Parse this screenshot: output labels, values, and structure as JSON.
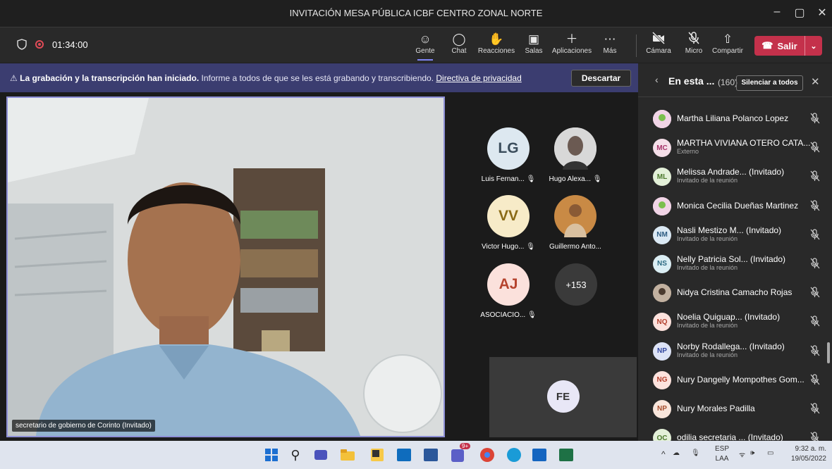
{
  "window": {
    "title": "INVITACIÓN MESA PÚBLICA ICBF CENTRO ZONAL NORTE"
  },
  "toolbar": {
    "timer": "01:34:00",
    "people": "Gente",
    "chat": "Chat",
    "reactions": "Reacciones",
    "rooms": "Salas",
    "apps": "Aplicaciones",
    "more": "Más",
    "camera": "Cámara",
    "mic": "Micro",
    "share": "Compartir",
    "leave": "Salir"
  },
  "banner": {
    "bold": "La grabación y la transcripción han iniciado.",
    "text": " Informe a todos de que se les está grabando y transcribiendo. ",
    "link": "Directiva de privacidad",
    "dismiss": "Descartar"
  },
  "stage": {
    "main_label": "secretario de gobierno de Corinto (Invitado)",
    "tiles": [
      {
        "initials": "LG",
        "name": "Luis Fernan..."
      },
      {
        "initials": "",
        "name": "Hugo Alexa..."
      },
      {
        "initials": "VV",
        "name": "Victor Hugo..."
      },
      {
        "initials": "",
        "name": "Guillermo Anto..."
      },
      {
        "initials": "AJ",
        "name": "ASOCIACIO..."
      }
    ],
    "more_count": "+153",
    "self_initials": "FE"
  },
  "panel": {
    "title": "En esta ...",
    "count": "(160)",
    "mute_all": "Silenciar a todos",
    "participants": [
      {
        "initials": "",
        "name": "Martha Liliana Polanco Lopez",
        "sub": ""
      },
      {
        "initials": "MC",
        "name": "MARTHA VIVIANA OTERO CATA...",
        "sub": "Externo"
      },
      {
        "initials": "ML",
        "name": "Melissa Andrade... (Invitado)",
        "sub": "Invitado de la reunión"
      },
      {
        "initials": "",
        "name": "Monica Cecilia Dueñas Martinez",
        "sub": ""
      },
      {
        "initials": "NM",
        "name": "Nasli Mestizo M... (Invitado)",
        "sub": "Invitado de la reunión"
      },
      {
        "initials": "NS",
        "name": "Nelly Patricia Sol... (Invitado)",
        "sub": "Invitado de la reunión"
      },
      {
        "initials": "",
        "name": "Nidya Cristina Camacho Rojas",
        "sub": ""
      },
      {
        "initials": "NQ",
        "name": "Noelia Quiguap... (Invitado)",
        "sub": "Invitado de la reunión"
      },
      {
        "initials": "NP",
        "name": "Norby Rodallega... (Invitado)",
        "sub": "Invitado de la reunión"
      },
      {
        "initials": "NG",
        "name": "Nury Dangelly Mompothes Gom...",
        "sub": ""
      },
      {
        "initials": "NP",
        "name": "Nury Morales Padilla",
        "sub": ""
      },
      {
        "initials": "OC",
        "name": "odilia secretaria ... (Invitado)",
        "sub": ""
      }
    ]
  },
  "taskbar": {
    "teams_badge": "9+",
    "lang": "ESP",
    "layout": "LAA",
    "time": "9:32 a. m.",
    "date": "19/05/2022"
  }
}
